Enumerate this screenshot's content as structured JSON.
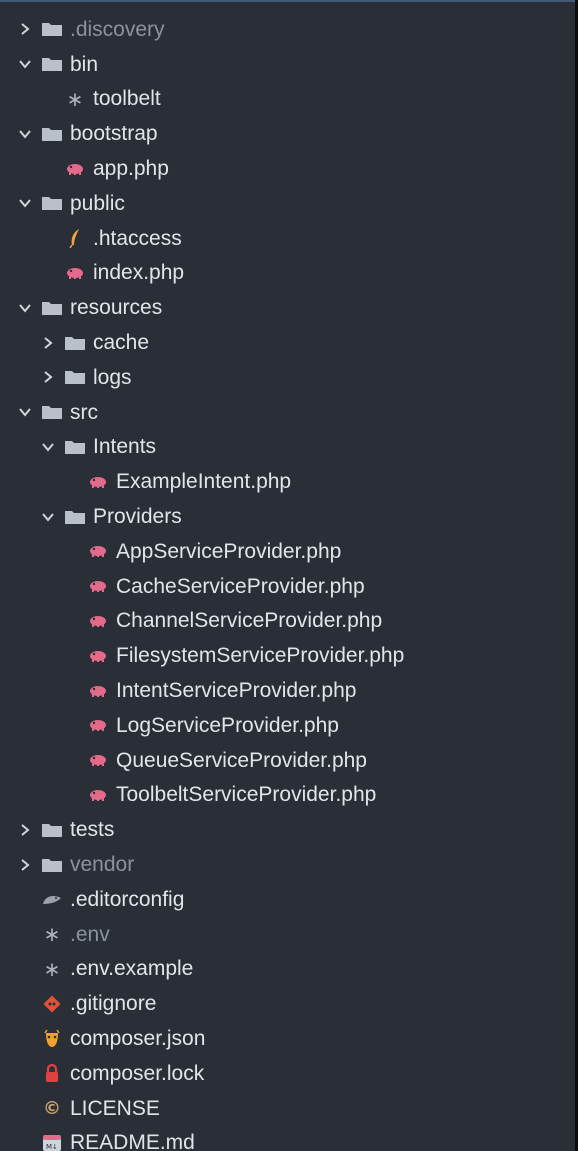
{
  "tree": {
    "items": [
      {
        "label": ".discovery",
        "type": "folder",
        "expanded": false,
        "depth": 0,
        "dim": true
      },
      {
        "label": "bin",
        "type": "folder",
        "expanded": true,
        "depth": 0
      },
      {
        "label": "toolbelt",
        "type": "file",
        "icon": "asterisk-icon",
        "depth": 1
      },
      {
        "label": "bootstrap",
        "type": "folder",
        "expanded": true,
        "depth": 0
      },
      {
        "label": "app.php",
        "type": "file",
        "icon": "php-elephant-icon",
        "depth": 1
      },
      {
        "label": "public",
        "type": "folder",
        "expanded": true,
        "depth": 0
      },
      {
        "label": ".htaccess",
        "type": "file",
        "icon": "feather-icon",
        "depth": 1
      },
      {
        "label": "index.php",
        "type": "file",
        "icon": "php-elephant-icon",
        "depth": 1
      },
      {
        "label": "resources",
        "type": "folder",
        "expanded": true,
        "depth": 0
      },
      {
        "label": "cache",
        "type": "folder",
        "expanded": false,
        "depth": 1
      },
      {
        "label": "logs",
        "type": "folder",
        "expanded": false,
        "depth": 1
      },
      {
        "label": "src",
        "type": "folder",
        "expanded": true,
        "depth": 0
      },
      {
        "label": "Intents",
        "type": "folder",
        "expanded": true,
        "depth": 1
      },
      {
        "label": "ExampleIntent.php",
        "type": "file",
        "icon": "php-elephant-icon",
        "depth": 2
      },
      {
        "label": "Providers",
        "type": "folder",
        "expanded": true,
        "depth": 1
      },
      {
        "label": "AppServiceProvider.php",
        "type": "file",
        "icon": "php-elephant-icon",
        "depth": 2
      },
      {
        "label": "CacheServiceProvider.php",
        "type": "file",
        "icon": "php-elephant-icon",
        "depth": 2
      },
      {
        "label": "ChannelServiceProvider.php",
        "type": "file",
        "icon": "php-elephant-icon",
        "depth": 2
      },
      {
        "label": "FilesystemServiceProvider.php",
        "type": "file",
        "icon": "php-elephant-icon",
        "depth": 2
      },
      {
        "label": "IntentServiceProvider.php",
        "type": "file",
        "icon": "php-elephant-icon",
        "depth": 2
      },
      {
        "label": "LogServiceProvider.php",
        "type": "file",
        "icon": "php-elephant-icon",
        "depth": 2
      },
      {
        "label": "QueueServiceProvider.php",
        "type": "file",
        "icon": "php-elephant-icon",
        "depth": 2
      },
      {
        "label": "ToolbeltServiceProvider.php",
        "type": "file",
        "icon": "php-elephant-icon",
        "depth": 2
      },
      {
        "label": "tests",
        "type": "folder",
        "expanded": false,
        "depth": 0
      },
      {
        "label": "vendor",
        "type": "folder",
        "expanded": false,
        "depth": 0,
        "dim": true
      },
      {
        "label": ".editorconfig",
        "type": "file",
        "icon": "mouse-icon",
        "depth": 0
      },
      {
        "label": ".env",
        "type": "file",
        "icon": "asterisk-icon",
        "depth": 0,
        "dim": true
      },
      {
        "label": ".env.example",
        "type": "file",
        "icon": "asterisk-icon",
        "depth": 0
      },
      {
        "label": ".gitignore",
        "type": "file",
        "icon": "git-icon",
        "depth": 0
      },
      {
        "label": "composer.json",
        "type": "file",
        "icon": "composer-icon",
        "depth": 0
      },
      {
        "label": "composer.lock",
        "type": "file",
        "icon": "lock-icon",
        "depth": 0
      },
      {
        "label": "LICENSE",
        "type": "file",
        "icon": "copyright-icon",
        "depth": 0
      },
      {
        "label": "README.md",
        "type": "file",
        "icon": "markdown-icon",
        "depth": 0
      }
    ]
  },
  "colors": {
    "panel_bg": "#2a2f37",
    "text": "#e1e5ea",
    "dim_text": "#8a939d",
    "folder": "#b9c0c9",
    "php": "#e36a8a",
    "feather": "#f2a33a",
    "git": "#e0533a",
    "composer": "#f0a030",
    "lock": "#e04040",
    "license": "#c9a16a"
  }
}
